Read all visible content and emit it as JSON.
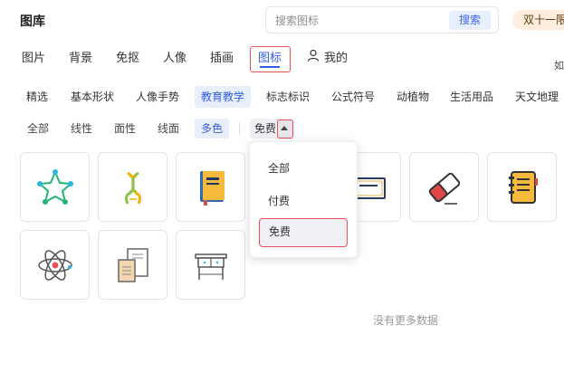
{
  "header": {
    "title": "图库",
    "search_placeholder": "搜索图标",
    "search_button": "搜索",
    "promo": "双十一限"
  },
  "main_tabs": {
    "items": [
      "图片",
      "背景",
      "免抠",
      "人像",
      "插画",
      "图标"
    ],
    "active": "图标",
    "mine": "我的",
    "edge_text": "如"
  },
  "categories": [
    "精选",
    "基本形状",
    "人像手势",
    "教育教学",
    "标志标识",
    "公式符号",
    "动植物",
    "生活用品",
    "天文地理"
  ],
  "active_category": "教育教学",
  "styles": [
    "全部",
    "线性",
    "面性",
    "线面",
    "多色"
  ],
  "active_style": "多色",
  "price_filter": {
    "current": "免费",
    "options": [
      "全部",
      "付费",
      "免费"
    ],
    "selected": "免费"
  },
  "icons": [
    "star-network-icon",
    "dna-helix-icon",
    "notebook-icon",
    "certificate-icon",
    "eraser-icon",
    "spiral-notebook-icon",
    "atom-icon",
    "scroll-document-icon",
    "desk-icon"
  ],
  "empty_message": "没有更多数据",
  "colors": {
    "accent": "#2f5fe0",
    "highlight_border": "#e8505b"
  }
}
